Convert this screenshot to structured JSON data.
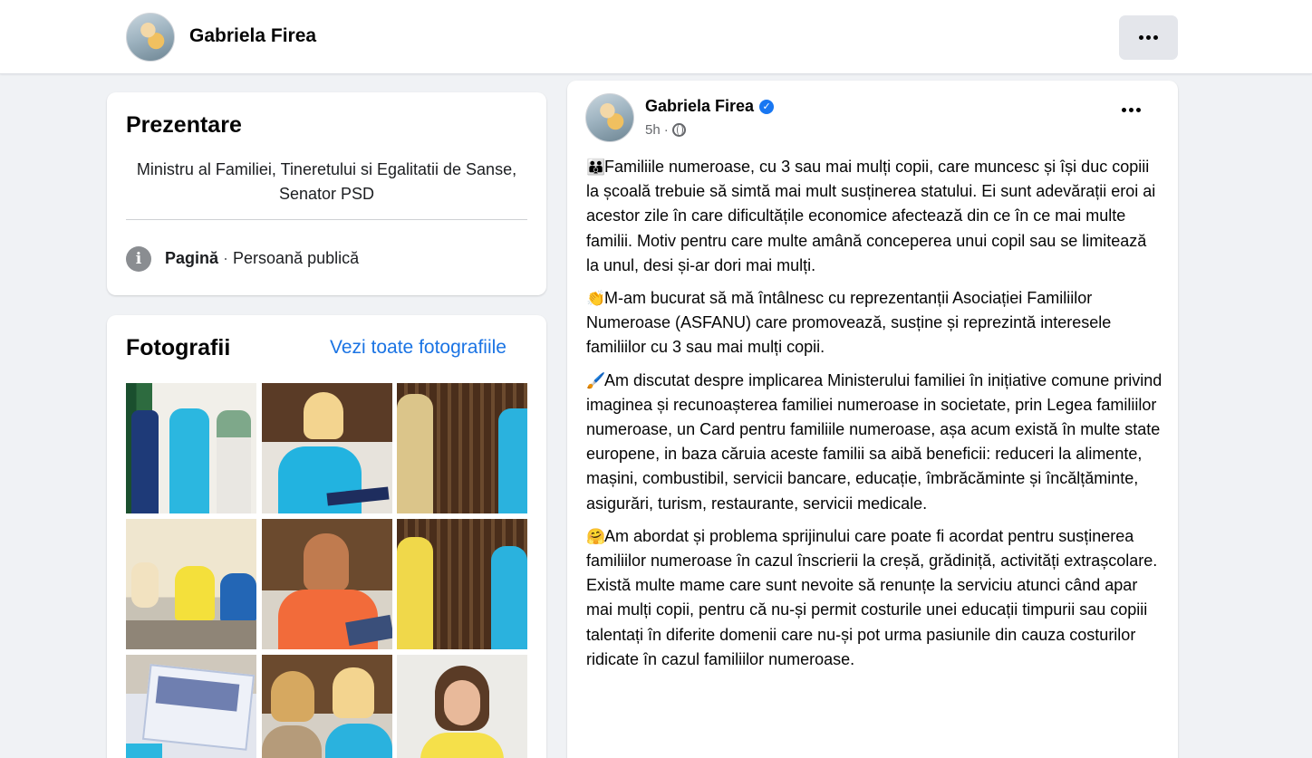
{
  "header": {
    "name": "Gabriela Firea",
    "avatar_icon": "profile-avatar",
    "more_icon": "more-horizontal-icon"
  },
  "intro": {
    "title": "Prezentare",
    "bio": "Ministru al Familiei, Tineretului si Egalitatii de Sanse, Senator PSD",
    "category_label": "Pagină",
    "category_sep": " · ",
    "category_value": "Persoană publică",
    "info_icon": "info-icon"
  },
  "photos": {
    "title": "Fotografii",
    "see_all": "Vezi toate fotografiile",
    "items_count_shown": 9
  },
  "post": {
    "author": "Gabriela Firea",
    "verified": true,
    "time": "5h",
    "time_sep": "·",
    "audience_icon": "globe-icon",
    "paragraphs": [
      {
        "emoji": "👪",
        "text": "Familiile numeroase, cu 3 sau mai mulți copii, care muncesc și își duc copiii la școală trebuie să simtă mai mult susținerea statului. Ei sunt adevărații eroi ai acestor zile în care dificultățile economice afectează din ce în ce mai multe familii. Motiv pentru care multe amână conceperea unui copil sau se limitează la unul, desi și-ar dori mai mulți."
      },
      {
        "emoji": "👏",
        "text": "M-am bucurat să mă întâlnesc cu reprezentanții Asociației Familiilor Numeroase (ASFANU) care promovează, susține și reprezintă interesele familiilor cu 3 sau mai mulți copii."
      },
      {
        "emoji": "🖌️",
        "text": "Am discutat despre implicarea Ministerului familiei în inițiative comune privind imaginea și recunoașterea familiei numeroase in societate, prin Legea familiilor numeroase, un Card pentru familiile numeroase, așa acum există în multe state europene, in baza căruia aceste familii sa aibă beneficii: reduceri la alimente, mașini, combustibil, servicii bancare, educație, îmbrăcăminte și încălțăminte, asigurări, turism, restaurante, servicii medicale."
      },
      {
        "emoji": "🤗",
        "text": "Am abordat și problema sprijinului care poate fi acordat pentru susținerea familiilor numeroase în cazul înscrierii la creșă, grădiniță, activități extrașcolare. Există multe mame care sunt nevoite să renunțe la serviciu atunci când apar mai mulți copii, pentru că nu-și permit costurile unei educații timpurii sau copiii talentați în diferite domenii care nu-și pot urma pasiunile din cauza costurilor ridicate în cazul familiilor numeroase."
      }
    ]
  },
  "colors": {
    "background": "#f0f2f5",
    "card": "#ffffff",
    "link": "#1b74e4",
    "verified": "#1877f2",
    "secondary_text": "#65676b"
  }
}
